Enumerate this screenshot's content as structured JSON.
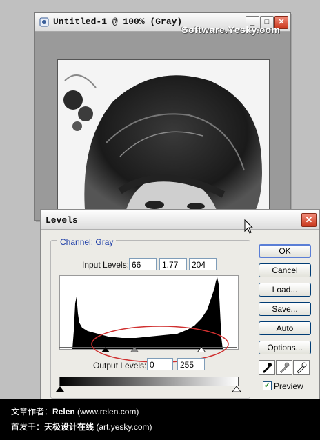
{
  "document_window": {
    "title": "Untitled-1 @ 100% (Gray)",
    "watermark": "Software.Yesky.com",
    "minimize_label": "_",
    "maximize_label": "□",
    "close_label": "✕"
  },
  "levels_dialog": {
    "title": "Levels",
    "close_label": "✕",
    "channel_label": "Channel: Gray",
    "input_levels_label": "Input Levels:",
    "input_black": "66",
    "input_gamma": "1.77",
    "input_white": "204",
    "output_levels_label": "Output Levels:",
    "output_black": "0",
    "output_white": "255",
    "buttons": {
      "ok": "OK",
      "cancel": "Cancel",
      "load": "Load...",
      "save": "Save...",
      "auto": "Auto",
      "options": "Options..."
    },
    "preview_label": "Preview",
    "preview_checked": true
  },
  "credits": {
    "author_prefix": "文章作者：",
    "author_name": "Relen",
    "author_site": "(www.relen.com)",
    "published_prefix": "首发于：",
    "published_name": "天极设计在线",
    "published_site": "(art.yesky.com)"
  },
  "icons": [
    "photoshop-document-icon",
    "minimize-icon",
    "maximize-icon",
    "close-icon",
    "black-eyedropper-icon",
    "gray-eyedropper-icon",
    "white-eyedropper-icon",
    "mouse-cursor-icon",
    "checkbox-check-icon"
  ],
  "colors": {
    "dialog_bg": "#ecebe6",
    "channel_label": "#1f3fa8",
    "annotation_ellipse": "#d03030",
    "close_button": "#c9371c"
  }
}
